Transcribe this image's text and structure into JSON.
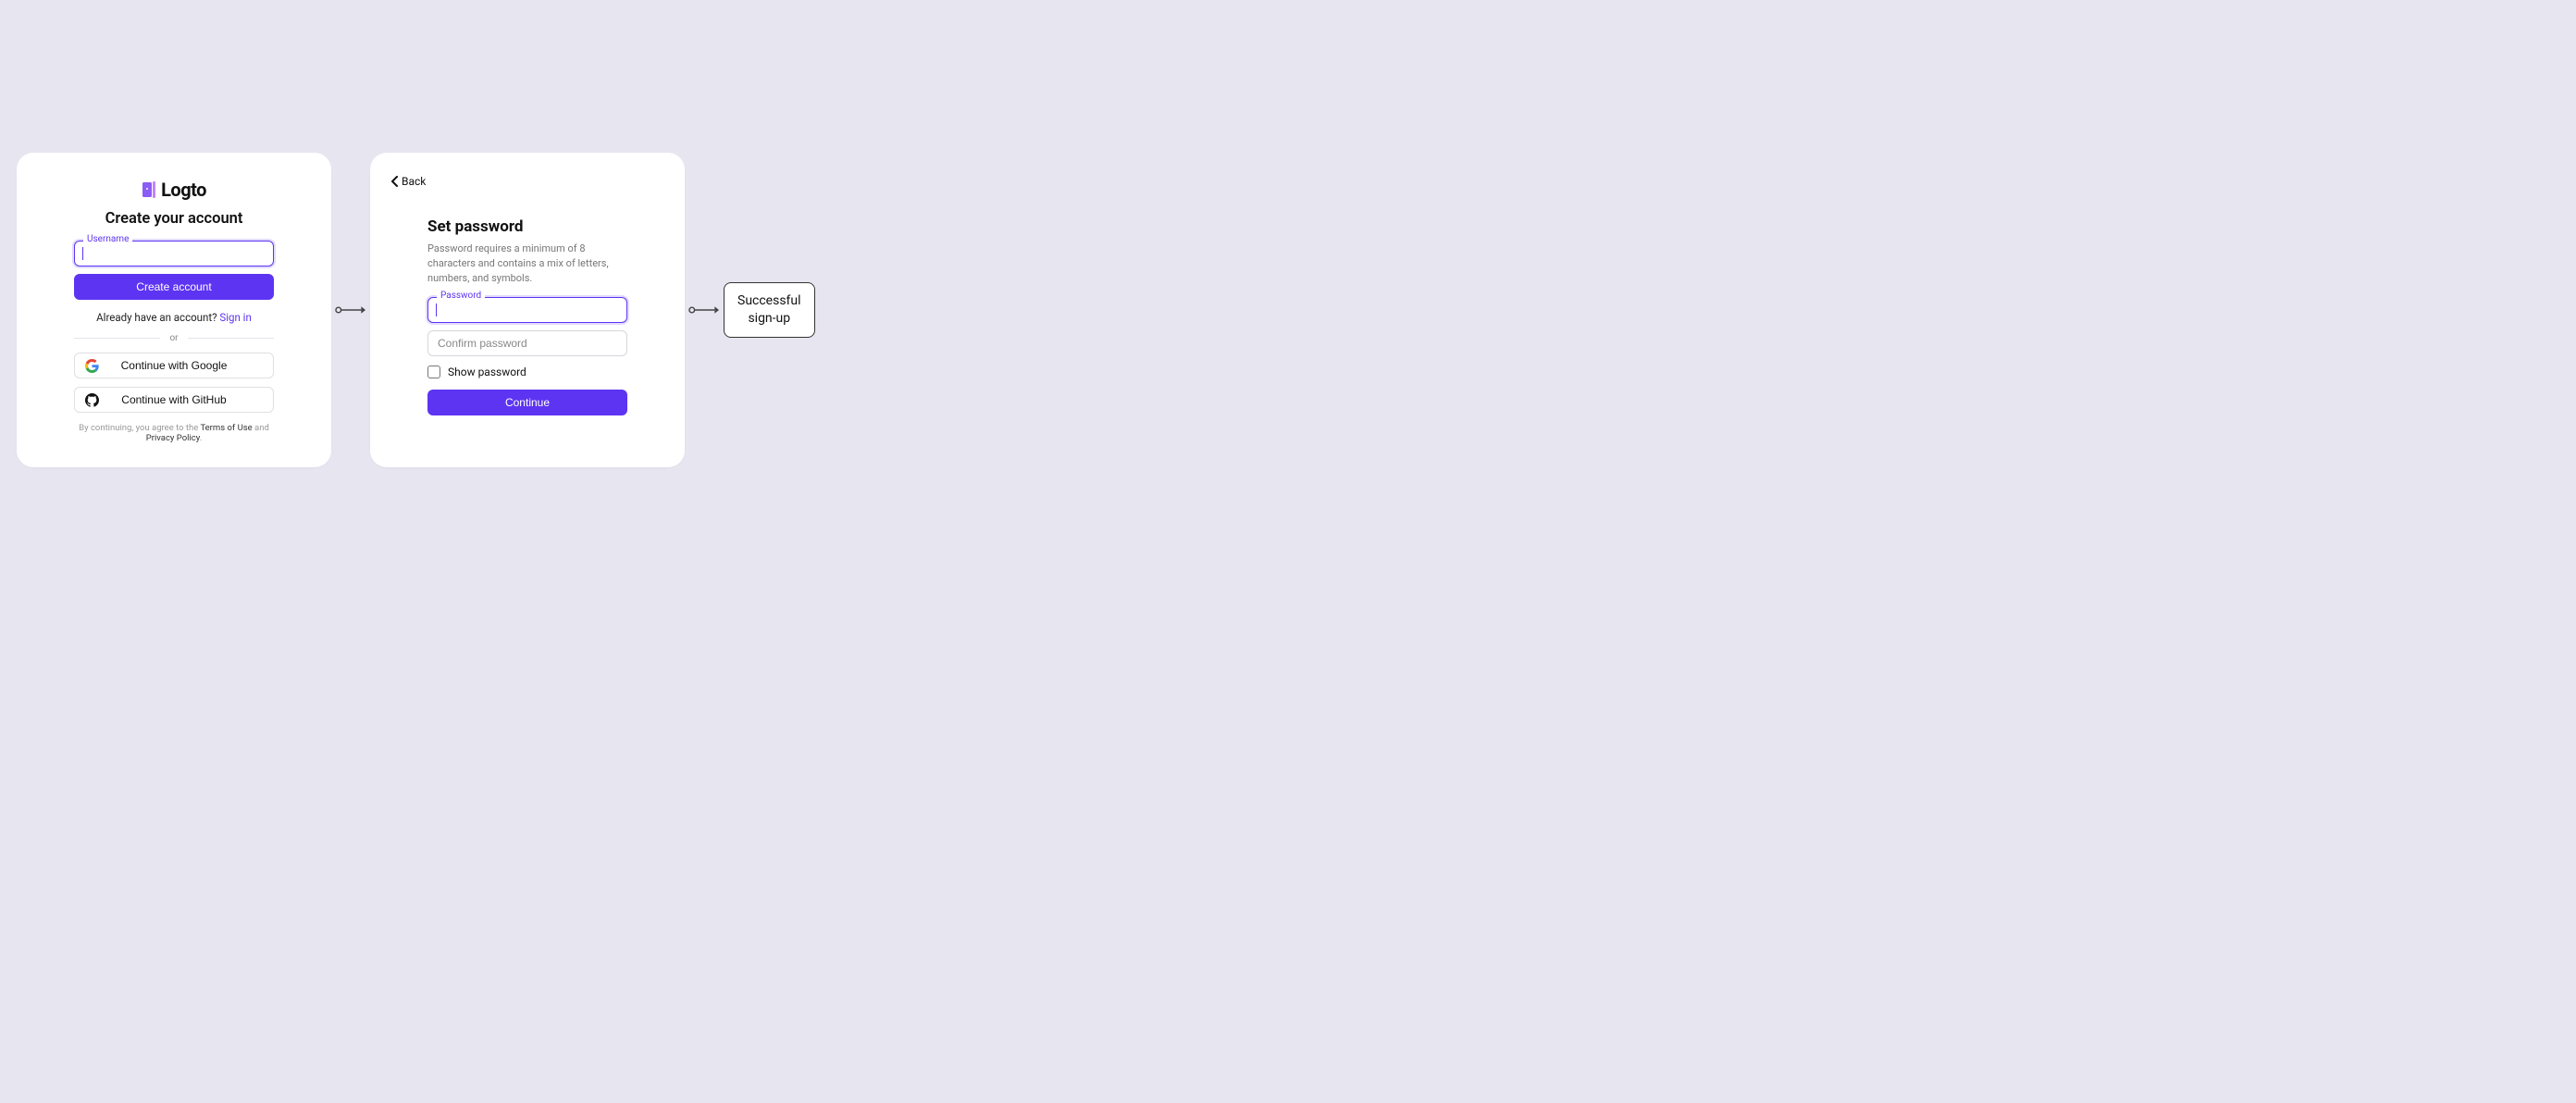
{
  "brand": {
    "name": "Logto"
  },
  "card1": {
    "headline": "Create your account",
    "username_label": "Username",
    "create_button": "Create account",
    "already_text": "Already have an account? ",
    "signin_link": "Sign in",
    "divider": "or",
    "google_button": "Continue with Google",
    "github_button": "Continue with GitHub",
    "legal_prefix": "By continuing, you agree to the ",
    "legal_terms": "Terms of Use",
    "legal_and": " and ",
    "legal_privacy": "Privacy Policy",
    "legal_suffix": "."
  },
  "card2": {
    "back": "Back",
    "headline": "Set password",
    "subtext": "Password requires a minimum of 8 characters and contains a mix of letters, numbers, and symbols.",
    "password_label": "Password",
    "confirm_placeholder": "Confirm password",
    "show_password": "Show password",
    "continue_button": "Continue"
  },
  "result": {
    "line1": "Successful",
    "line2": "sign-up"
  }
}
